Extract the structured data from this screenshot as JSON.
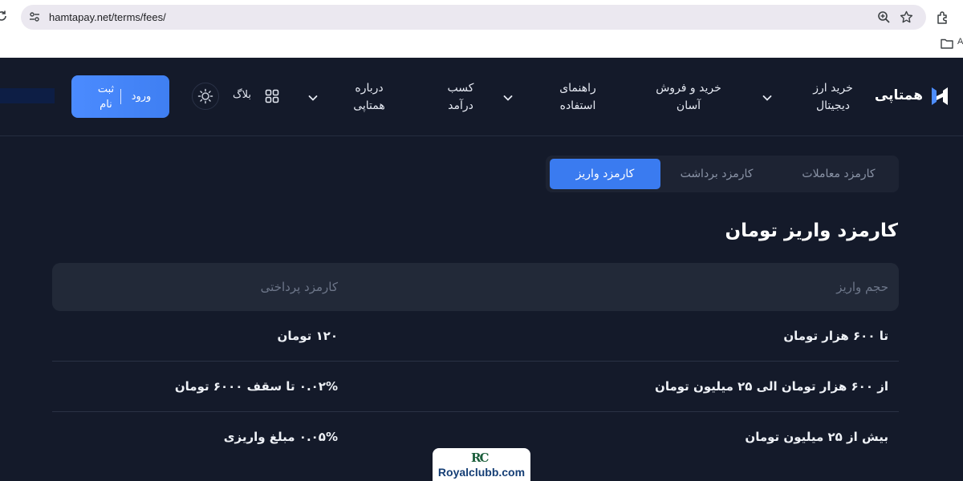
{
  "browser": {
    "url": "hamtapay.net/terms/fees/",
    "bookmark_label": "A",
    "icons": [
      "reload-icon",
      "site-info-icon",
      "zoom-icon",
      "star-icon",
      "extensions-icon",
      "folder-icon"
    ]
  },
  "header": {
    "logo_text": "همتاپی",
    "nav": {
      "buy_crypto": "خرید ارز دیجیتال",
      "buy_easy": "خرید و فروش آسان",
      "guide": "راهنمای استفاده",
      "income": "کسب درآمد",
      "about": "درباره همتاپی",
      "blog": "بلاگ"
    },
    "auth": {
      "login": "ورود",
      "register": "ثبت نام"
    }
  },
  "tabs": {
    "trades": "کارمزد معاملات",
    "withdraw": "کارمزد برداشت",
    "deposit": "کارمزد واریز",
    "active": "deposit"
  },
  "section": {
    "title": "کارمزد واریز تومان",
    "table": {
      "headers": {
        "volume": "حجم واریز",
        "fee": "کارمزد پرداختی"
      },
      "rows": [
        {
          "volume": "تا ۶۰۰ هزار تومان",
          "fee": "۱۲۰ تومان"
        },
        {
          "volume": "از ۶۰۰ هزار تومان الی ۲۵ میلیون تومان",
          "fee": "۰.۰۲% تا سقف ۶۰۰۰ تومان"
        },
        {
          "volume": "بیش از ۲۵ میلیون تومان",
          "fee": "۰.۰۵% مبلغ واریزی"
        }
      ]
    }
  },
  "watermark": {
    "mark": "RC",
    "text": "Royalclubb.com"
  },
  "colors": {
    "background": "#141a2a",
    "accent": "#3a7bf0",
    "table_header": "#222938",
    "muted_text": "#6d7689"
  }
}
